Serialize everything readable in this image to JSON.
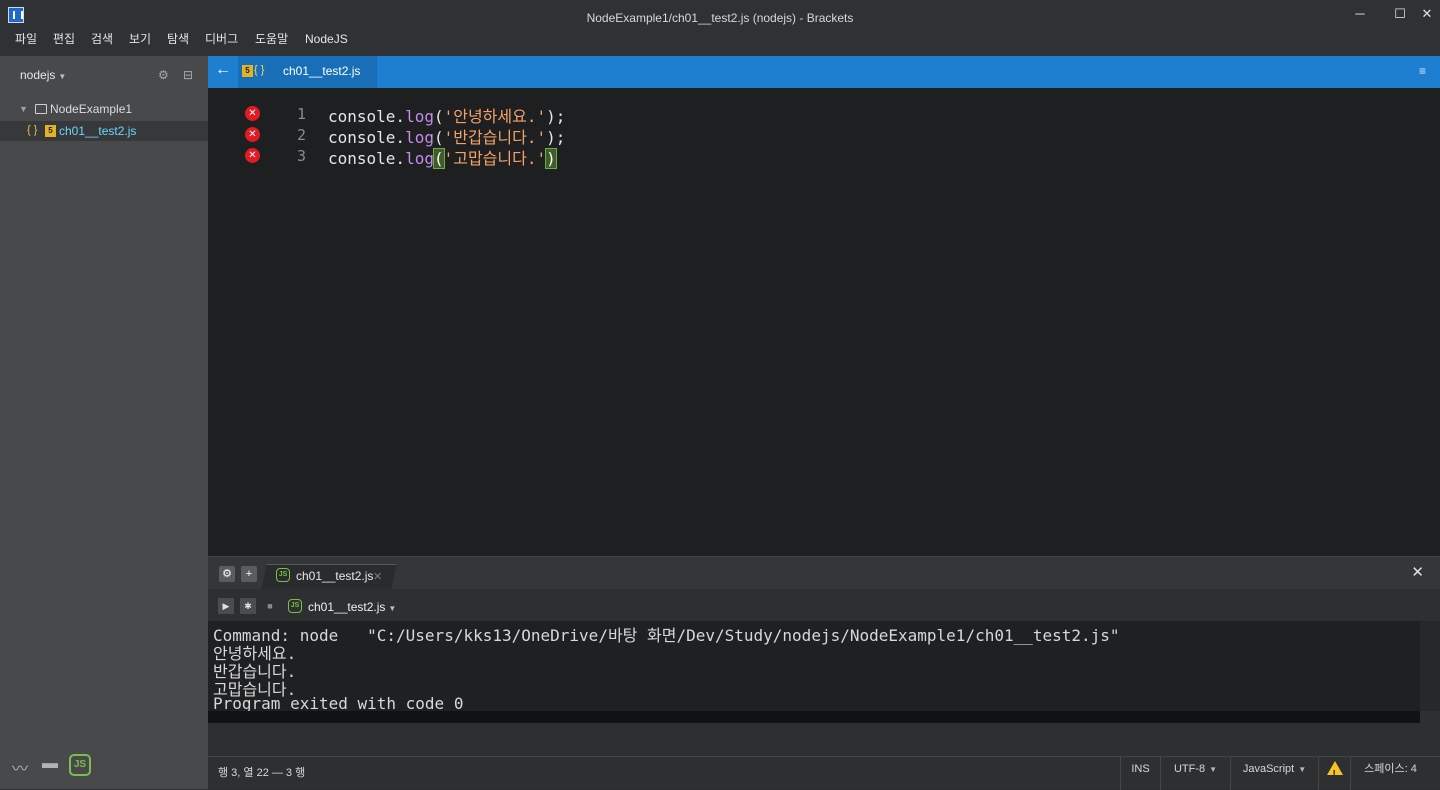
{
  "window": {
    "title": "NodeExample1/ch01__test2.js (nodejs) - Brackets",
    "minimize": "─",
    "maximize": "☐",
    "close": "✕"
  },
  "menu": [
    "파일",
    "편집",
    "검색",
    "보기",
    "탐색",
    "디버그",
    "도움말",
    "NodeJS"
  ],
  "sidebar": {
    "project": "nodejs",
    "folder": "NodeExample1",
    "file_brace": "{ }",
    "file_badge": "5",
    "file": "ch01__test2.js"
  },
  "editor_tab": {
    "back": "←",
    "badge": "5",
    "braces": "{ }",
    "label": "ch01__test2.js",
    "menu": "≡"
  },
  "code": {
    "lines": [
      {
        "no": "1",
        "obj": "console.",
        "fn": "log",
        "open": "(",
        "str": "'안녕하세요.'",
        "close": ");"
      },
      {
        "no": "2",
        "obj": "console.",
        "fn": "log",
        "open": "(",
        "str": "'반갑습니다.'",
        "close": ");"
      },
      {
        "no": "3",
        "obj": "console.",
        "fn": "log",
        "open": "(",
        "str": "'고맙습니다.'",
        "close": ")"
      }
    ],
    "error_icon": "✕"
  },
  "panel": {
    "tab_label": "ch01__test2.js",
    "tab_close": "✕",
    "gear": "⚙",
    "plus": "+",
    "close": "✕",
    "play": "▶",
    "debug": "✱",
    "stop": "■",
    "run_file": "ch01__test2.js",
    "node_badge": "JS",
    "console": [
      "Command: node   \"C:/Users/kks13/OneDrive/바탕 화면/Dev/Study/nodejs/NodeExample1/ch01__test2.js\"",
      "안녕하세요.",
      "반갑습니다.",
      "고맙습니다.",
      "Program exited with code 0"
    ]
  },
  "status": {
    "position": "행 3, 열 22 — 3 행",
    "mode": "INS",
    "encoding": "UTF-8",
    "language": "JavaScript",
    "indent": "스페이스: 4"
  }
}
